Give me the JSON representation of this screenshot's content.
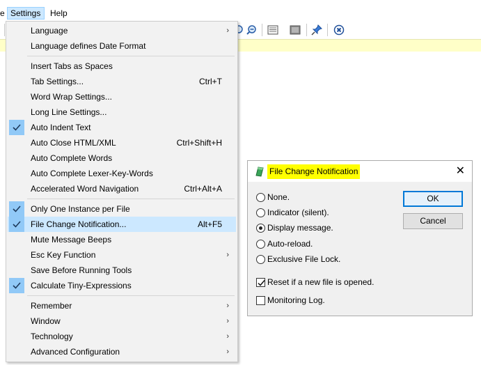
{
  "menubar": {
    "partial_label": "e",
    "settings_label": "Settings",
    "help_label": "Help"
  },
  "toolbar": {
    "icons": [
      "zoom-in-icon",
      "zoom-out-icon",
      "scheme-icon",
      "fullscreen-icon",
      "pin-icon",
      "close-icon"
    ]
  },
  "menu": {
    "items": [
      {
        "label": "Language",
        "submenu": true
      },
      {
        "label": "Language defines Date Format"
      },
      {
        "label": "Insert Tabs as Spaces"
      },
      {
        "label": "Tab Settings...",
        "shortcut": "Ctrl+T"
      },
      {
        "label": "Word Wrap Settings..."
      },
      {
        "label": "Long Line Settings..."
      },
      {
        "label": "Auto Indent Text",
        "checked": true
      },
      {
        "label": "Auto Close HTML/XML",
        "shortcut": "Ctrl+Shift+H"
      },
      {
        "label": "Auto Complete Words"
      },
      {
        "label": "Auto Complete Lexer-Key-Words"
      },
      {
        "label": "Accelerated Word Navigation",
        "shortcut": "Ctrl+Alt+A"
      },
      {
        "label": "Only One Instance per File",
        "checked": true
      },
      {
        "label": "File Change Notification...",
        "shortcut": "Alt+F5",
        "checked": true,
        "highlighted": true
      },
      {
        "label": "Mute Message Beeps"
      },
      {
        "label": "Esc Key Function",
        "submenu": true
      },
      {
        "label": "Save Before Running Tools"
      },
      {
        "label": "Calculate Tiny-Expressions",
        "checked": true
      },
      {
        "label": "Remember",
        "submenu": true
      },
      {
        "label": "Window",
        "submenu": true
      },
      {
        "label": "Technology",
        "submenu": true
      },
      {
        "label": "Advanced Configuration",
        "submenu": true
      }
    ],
    "submenu_arrow": "›"
  },
  "dialog": {
    "title": "File Change Notification",
    "close_glyph": "✕",
    "radios": [
      {
        "label": "None.",
        "selected": false
      },
      {
        "label": "Indicator (silent).",
        "selected": false
      },
      {
        "label": "Display message.",
        "selected": true
      },
      {
        "label": "Auto-reload.",
        "selected": false
      },
      {
        "label": "Exclusive File Lock.",
        "selected": false
      }
    ],
    "checkboxes": [
      {
        "label": "Reset if a new file is opened.",
        "checked": true
      },
      {
        "label": "Monitoring Log.",
        "checked": false
      }
    ],
    "ok_label": "OK",
    "cancel_label": "Cancel"
  },
  "colors": {
    "menu_highlight": "#cce8ff",
    "check_bg": "#91c9f7",
    "title_highlight": "#ffff00",
    "info_bar": "#ffffc8"
  }
}
